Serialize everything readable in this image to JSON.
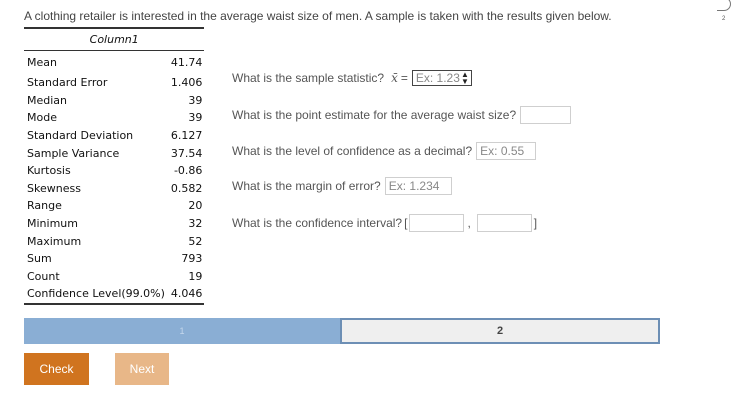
{
  "intro": "A clothing retailer is interested in the average waist size of men. A sample is taken with the results given below.",
  "corner_label": "2",
  "table": {
    "header": "Column1",
    "rows": [
      {
        "label": "Mean",
        "value": "41.74"
      },
      {
        "label": "Standard Error",
        "value": "1.406"
      },
      {
        "label": "Median",
        "value": "39"
      },
      {
        "label": "Mode",
        "value": "39"
      },
      {
        "label": "Standard Deviation",
        "value": "6.127"
      },
      {
        "label": "Sample Variance",
        "value": "37.54"
      },
      {
        "label": "Kurtosis",
        "value": "-0.86"
      },
      {
        "label": "Skewness",
        "value": "0.582"
      },
      {
        "label": "Range",
        "value": "20"
      },
      {
        "label": "Minimum",
        "value": "32"
      },
      {
        "label": "Maximum",
        "value": "52"
      },
      {
        "label": "Sum",
        "value": "793"
      },
      {
        "label": "Count",
        "value": "19"
      },
      {
        "label": "Confidence Level(99.0%)",
        "value": "4.046"
      }
    ]
  },
  "questions": {
    "q1": {
      "text": "What is the sample statistic?",
      "symbol": "x̄",
      "eq": "=",
      "placeholder": "Ex: 1.23"
    },
    "q2": {
      "text": "What is the point estimate for the average waist size?",
      "placeholder": ""
    },
    "q3": {
      "text": "What is the level of confidence as a decimal?",
      "placeholder": "Ex: 0.55"
    },
    "q4": {
      "text": "What is the margin of error?",
      "placeholder": "Ex: 1.234"
    },
    "q5": {
      "text": "What is the confidence interval?",
      "open": "[",
      "sep": ",",
      "close": "]"
    }
  },
  "tabs": [
    "1",
    "2"
  ],
  "buttons": {
    "check": "Check",
    "next": "Next"
  }
}
